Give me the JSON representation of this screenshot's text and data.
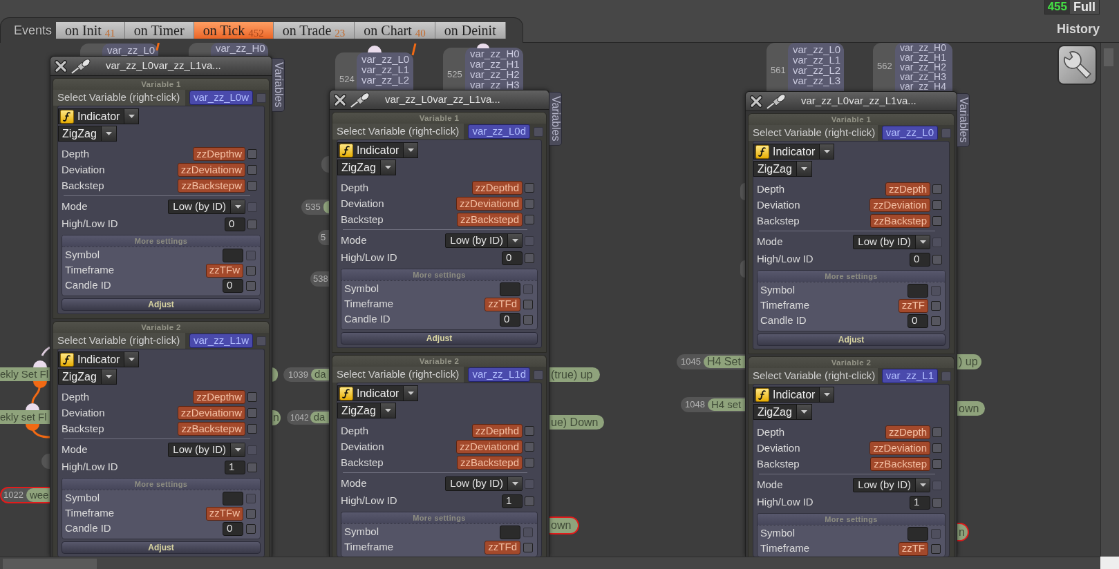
{
  "header": {
    "events_label": "Events",
    "tabs": [
      {
        "label": "on Init",
        "count": "41",
        "selected": false
      },
      {
        "label": "on Timer",
        "selected": false
      },
      {
        "label": "on Tick",
        "count": "452",
        "selected": true
      },
      {
        "label": "on Trade",
        "count": "23",
        "selected": false
      },
      {
        "label": "on Chart",
        "count": "40",
        "selected": false
      },
      {
        "label": "on Deinit",
        "selected": false
      }
    ],
    "counter": {
      "value": "455",
      "label": "Full"
    },
    "history_label": "History"
  },
  "canvas_nodes": [
    {
      "kind": "list",
      "lines": [
        "var_zz_L0"
      ]
    },
    {
      "kind": "list",
      "lines": [
        "var_zz_H0"
      ]
    },
    {
      "kind": "list",
      "number": "524",
      "lines": [
        "var_zz_L0",
        "var_zz_L1",
        "var_zz_L2"
      ]
    },
    {
      "kind": "list",
      "number": "525",
      "lines": [
        "var_zz_H0",
        "var_zz_H1",
        "var_zz_H2",
        "var_zz_H3"
      ]
    },
    {
      "kind": "list",
      "number": "561",
      "lines": [
        "var_zz_L0",
        "var_zz_L1",
        "var_zz_L2",
        "var_zz_L3"
      ]
    },
    {
      "kind": "list",
      "number": "562",
      "lines": [
        "var_zz_H0",
        "var_zz_H1",
        "var_zz_H2",
        "var_zz_H3",
        "var_zz_H4"
      ]
    },
    {
      "kind": "pill",
      "highlighted": false
    },
    {
      "kind": "pill",
      "highlighted": false
    },
    {
      "kind": "pill",
      "number": "535",
      "highlighted": false
    },
    {
      "kind": "pill",
      "number": "5",
      "highlighted": false
    },
    {
      "kind": "pill",
      "highlighted": false
    },
    {
      "kind": "pill",
      "number": "538",
      "highlighted": false
    },
    {
      "kind": "pill",
      "number": "1045",
      "label": "H4 Set",
      "highlighted": false
    },
    {
      "kind": "pill",
      "label": ") up",
      "highlighted": false
    },
    {
      "kind": "pill",
      "label": "ekly Set Fl",
      "highlighted": false
    },
    {
      "kind": "pill",
      "highlighted": false
    },
    {
      "kind": "pill",
      "number": "1039",
      "label": "da",
      "highlighted": false
    },
    {
      "kind": "pill",
      "label": "(true) up",
      "highlighted": false
    },
    {
      "kind": "pill",
      "number": "1048",
      "label": "H4 set",
      "highlighted": false
    },
    {
      "kind": "pill",
      "label": "own",
      "highlighted": false
    },
    {
      "kind": "pill",
      "label": "ekly set Fl",
      "highlighted": false
    },
    {
      "kind": "pill",
      "label": "n",
      "highlighted": false
    },
    {
      "kind": "pill",
      "number": "1042",
      "label": "da",
      "highlighted": false
    },
    {
      "kind": "pill",
      "label": "ue) Down",
      "highlighted": false
    },
    {
      "kind": "pill",
      "highlighted": false
    },
    {
      "kind": "pill",
      "number": "1022",
      "label": "wee",
      "highlighted": true
    },
    {
      "kind": "pill",
      "label": "own",
      "highlighted": true
    },
    {
      "kind": "pill",
      "label": "n",
      "highlighted": true
    }
  ],
  "dialogs": [
    {
      "title": "var_zz_L0var_zz_L1va...",
      "side_tab": "Variables",
      "variables": [
        {
          "heading": "Variable 1",
          "selector": {
            "label": "Select Variable (right-click)",
            "value": "var_zz_L0w",
            "checked": false,
            "disabled": true
          },
          "source": "Indicator",
          "indicator": "ZigZag",
          "params": [
            {
              "label": "Depth",
              "kind": "variable",
              "value": "zzDepthw",
              "checked": false,
              "disabled": false
            },
            {
              "label": "Deviation",
              "kind": "variable",
              "value": "zzDeviationw",
              "checked": false,
              "disabled": false
            },
            {
              "label": "Backstep",
              "kind": "variable",
              "value": "zzBackstepw",
              "checked": false,
              "disabled": false
            }
          ],
          "options": [
            {
              "label": "Mode",
              "kind": "select",
              "value": "Low (by ID)",
              "checked": false,
              "disabled": true
            },
            {
              "label": "High/Low ID",
              "kind": "input",
              "value": "0",
              "checked": false,
              "disabled": false
            }
          ],
          "more": {
            "heading": "More settings",
            "rows": [
              {
                "label": "Symbol",
                "kind": "input",
                "checked": false,
                "disabled": true
              },
              {
                "label": "Timeframe",
                "kind": "variable",
                "value": "zzTFw",
                "checked": false,
                "disabled": false
              },
              {
                "label": "Candle ID",
                "kind": "input",
                "value": "0",
                "checked": false,
                "disabled": false
              }
            ]
          },
          "button": "Adjust"
        },
        {
          "heading": "Variable 2",
          "selector": {
            "label": "Select Variable (right-click)",
            "value": "var_zz_L1w",
            "checked": false,
            "disabled": true
          },
          "source": "Indicator",
          "indicator": "ZigZag",
          "params": [
            {
              "label": "Depth",
              "kind": "variable",
              "value": "zzDepthw",
              "checked": false,
              "disabled": false
            },
            {
              "label": "Deviation",
              "kind": "variable",
              "value": "zzDeviationw",
              "checked": false,
              "disabled": false
            },
            {
              "label": "Backstep",
              "kind": "variable",
              "value": "zzBackstepw",
              "checked": false,
              "disabled": false
            }
          ],
          "options": [
            {
              "label": "Mode",
              "kind": "select",
              "value": "Low (by ID)",
              "checked": false,
              "disabled": true
            },
            {
              "label": "High/Low ID",
              "kind": "input",
              "value": "1",
              "checked": false,
              "disabled": false
            }
          ],
          "more": {
            "heading": "More settings",
            "rows": [
              {
                "label": "Symbol",
                "kind": "input",
                "checked": false,
                "disabled": true
              },
              {
                "label": "Timeframe",
                "kind": "variable",
                "value": "zzTFw",
                "checked": false,
                "disabled": false
              },
              {
                "label": "Candle ID",
                "kind": "input",
                "value": "0",
                "checked": false,
                "disabled": false
              }
            ]
          },
          "button": "Adjust"
        }
      ]
    },
    {
      "title": "var_zz_L0var_zz_L1va...",
      "side_tab": "Variables",
      "variables": [
        {
          "heading": "Variable 1",
          "selector": {
            "label": "Select Variable (right-click)",
            "value": "var_zz_L0d",
            "checked": false,
            "disabled": true
          },
          "source": "Indicator",
          "indicator": "ZigZag",
          "params": [
            {
              "label": "Depth",
              "kind": "variable",
              "value": "zzDepthd",
              "checked": false,
              "disabled": false
            },
            {
              "label": "Deviation",
              "kind": "variable",
              "value": "zzDeviationd",
              "checked": false,
              "disabled": false
            },
            {
              "label": "Backstep",
              "kind": "variable",
              "value": "zzBackstepd",
              "checked": false,
              "disabled": false
            }
          ],
          "options": [
            {
              "label": "Mode",
              "kind": "select",
              "value": "Low (by ID)",
              "checked": false,
              "disabled": true
            },
            {
              "label": "High/Low ID",
              "kind": "input",
              "value": "0",
              "checked": false,
              "disabled": false
            }
          ],
          "more": {
            "heading": "More settings",
            "rows": [
              {
                "label": "Symbol",
                "kind": "input",
                "checked": false,
                "disabled": true
              },
              {
                "label": "Timeframe",
                "kind": "variable",
                "value": "zzTFd",
                "checked": false,
                "disabled": false
              },
              {
                "label": "Candle ID",
                "kind": "input",
                "value": "0",
                "checked": false,
                "disabled": false
              }
            ]
          },
          "button": "Adjust"
        },
        {
          "heading": "Variable 2",
          "selector": {
            "label": "Select Variable (right-click)",
            "value": "var_zz_L1d",
            "checked": false,
            "disabled": true
          },
          "source": "Indicator",
          "indicator": "ZigZag",
          "params": [
            {
              "label": "Depth",
              "kind": "variable",
              "value": "zzDepthd",
              "checked": false,
              "disabled": false
            },
            {
              "label": "Deviation",
              "kind": "variable",
              "value": "zzDeviationd",
              "checked": false,
              "disabled": false
            },
            {
              "label": "Backstep",
              "kind": "variable",
              "value": "zzBackstepd",
              "checked": false,
              "disabled": false
            }
          ],
          "options": [
            {
              "label": "Mode",
              "kind": "select",
              "value": "Low (by ID)",
              "checked": false,
              "disabled": true
            },
            {
              "label": "High/Low ID",
              "kind": "input",
              "value": "1",
              "checked": false,
              "disabled": false
            }
          ],
          "more": {
            "heading": "More settings",
            "rows": [
              {
                "label": "Symbol",
                "kind": "input",
                "checked": false,
                "disabled": true
              },
              {
                "label": "Timeframe",
                "kind": "variable",
                "value": "zzTFd",
                "checked": false,
                "disabled": false
              }
            ]
          }
        }
      ]
    },
    {
      "title": "var_zz_L0var_zz_L1va...",
      "side_tab": "Variables",
      "variables": [
        {
          "heading": "Variable 1",
          "selector": {
            "label": "Select Variable (right-click)",
            "value": "var_zz_L0",
            "checked": false,
            "disabled": true
          },
          "source": "Indicator",
          "indicator": "ZigZag",
          "params": [
            {
              "label": "Depth",
              "kind": "variable",
              "value": "zzDepth",
              "checked": false,
              "disabled": false
            },
            {
              "label": "Deviation",
              "kind": "variable",
              "value": "zzDeviation",
              "checked": false,
              "disabled": false
            },
            {
              "label": "Backstep",
              "kind": "variable",
              "value": "zzBackstep",
              "checked": false,
              "disabled": false
            }
          ],
          "options": [
            {
              "label": "Mode",
              "kind": "select",
              "value": "Low (by ID)",
              "checked": false,
              "disabled": true
            },
            {
              "label": "High/Low ID",
              "kind": "input",
              "value": "0",
              "checked": false,
              "disabled": false
            }
          ],
          "more": {
            "heading": "More settings",
            "rows": [
              {
                "label": "Symbol",
                "kind": "input",
                "checked": false,
                "disabled": true
              },
              {
                "label": "Timeframe",
                "kind": "variable",
                "value": "zzTF",
                "checked": false,
                "disabled": false
              },
              {
                "label": "Candle ID",
                "kind": "input",
                "value": "0",
                "checked": false,
                "disabled": false
              }
            ]
          },
          "button": "Adjust"
        },
        {
          "heading": "Variable 2",
          "selector": {
            "label": "Select Variable (right-click)",
            "value": "var_zz_L1",
            "checked": false,
            "disabled": true
          },
          "source": "Indicator",
          "indicator": "ZigZag",
          "params": [
            {
              "label": "Depth",
              "kind": "variable",
              "value": "zzDepth",
              "checked": false,
              "disabled": false
            },
            {
              "label": "Deviation",
              "kind": "variable",
              "value": "zzDeviation",
              "checked": false,
              "disabled": false
            },
            {
              "label": "Backstep",
              "kind": "variable",
              "value": "zzBackstep",
              "checked": false,
              "disabled": false
            }
          ],
          "options": [
            {
              "label": "Mode",
              "kind": "select",
              "value": "Low (by ID)",
              "checked": false,
              "disabled": true
            },
            {
              "label": "High/Low ID",
              "kind": "input",
              "value": "1",
              "checked": false,
              "disabled": false
            }
          ],
          "more": {
            "heading": "More settings",
            "rows": [
              {
                "label": "Symbol",
                "kind": "input",
                "checked": false,
                "disabled": true
              },
              {
                "label": "Timeframe",
                "kind": "variable",
                "value": "zzTF",
                "checked": false,
                "disabled": false
              }
            ]
          }
        }
      ]
    }
  ]
}
